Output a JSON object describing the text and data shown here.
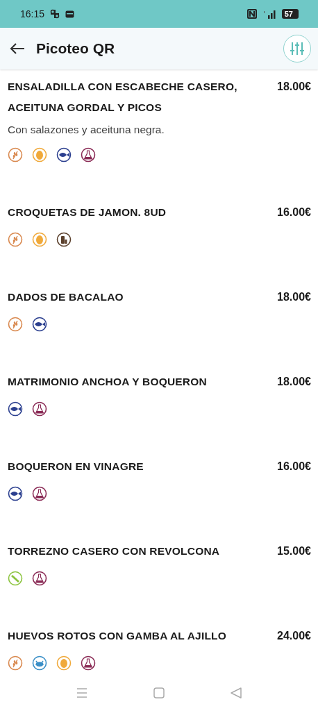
{
  "status_bar": {
    "time": "16:15",
    "battery": "57"
  },
  "header": {
    "title": "Picoteo QR"
  },
  "items": [
    {
      "name": "ENSALADILLA CON ESCABECHE CASERO, ACEITUNA GORDAL Y PICOS",
      "price": "18.00€",
      "description": "Con salazones y aceituna negra.",
      "allergens": [
        {
          "kind": "gluten"
        },
        {
          "kind": "egg"
        },
        {
          "kind": "fish"
        },
        {
          "kind": "sulphites"
        }
      ]
    },
    {
      "name": "CROQUETAS DE JAMON. 8UD",
      "price": "16.00€",
      "allergens": [
        {
          "kind": "gluten"
        },
        {
          "kind": "egg"
        },
        {
          "kind": "dairy"
        }
      ]
    },
    {
      "name": "DADOS DE BACALAO",
      "price": "18.00€",
      "allergens": [
        {
          "kind": "gluten"
        },
        {
          "kind": "fish"
        }
      ]
    },
    {
      "name": "MATRIMONIO ANCHOA Y BOQUERON",
      "price": "18.00€",
      "allergens": [
        {
          "kind": "fish"
        },
        {
          "kind": "sulphites"
        }
      ]
    },
    {
      "name": "BOQUERON EN VINAGRE",
      "price": "16.00€",
      "allergens": [
        {
          "kind": "fish"
        },
        {
          "kind": "sulphites"
        }
      ]
    },
    {
      "name": "TORREZNO CASERO CON REVOLCONA",
      "price": "15.00€",
      "allergens": [
        {
          "kind": "celery"
        },
        {
          "kind": "sulphites"
        }
      ]
    },
    {
      "name": "HUEVOS ROTOS CON GAMBA AL AJILLO",
      "price": "24.00€",
      "allergens": [
        {
          "kind": "gluten"
        },
        {
          "kind": "crustacean"
        },
        {
          "kind": "egg"
        },
        {
          "kind": "sulphites"
        }
      ]
    }
  ]
}
